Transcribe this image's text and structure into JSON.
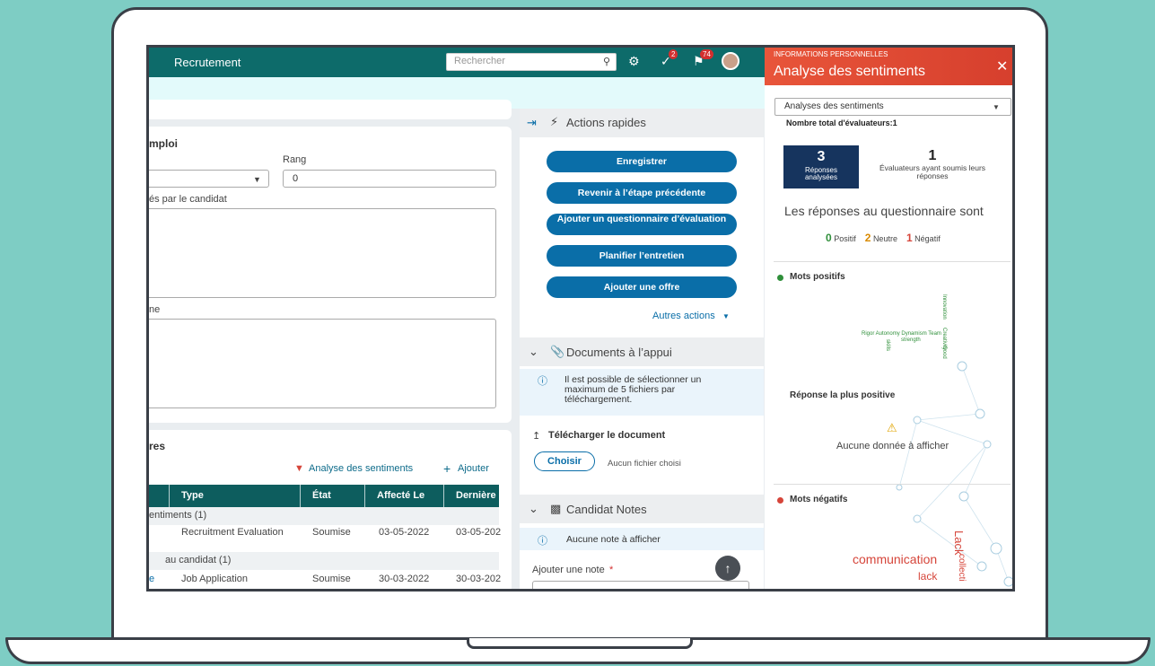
{
  "topbar": {
    "title": "Recrutement",
    "search_placeholder": "Rechercher",
    "badge_1": "2",
    "badge_2": "74"
  },
  "form": {
    "section_title": "mploi",
    "rank_label": "Rang",
    "rank_value": "0",
    "candidate_label": "és par le candidat",
    "other_label": "ne"
  },
  "evaluations": {
    "section_title": "res",
    "sentiment_link": "Analyse des sentiments",
    "add_link": "Ajouter",
    "columns": [
      "Type",
      "État",
      "Affecté Le",
      "Dernière"
    ],
    "groups": [
      {
        "label": "entiments (1)",
        "rows": [
          {
            "type": "Recruitment Evaluation",
            "state": "Soumise",
            "assigned": "03-05-2022",
            "last": "03-05-202"
          }
        ]
      },
      {
        "label": "au candidat (1)",
        "rows": [
          {
            "type": "Job Application",
            "state": "Soumise",
            "assigned": "30-03-2022",
            "last": "30-03-202"
          }
        ]
      }
    ]
  },
  "quick_actions": {
    "title": "Actions rapides",
    "buttons": [
      "Enregistrer",
      "Revenir à l’étape précédente",
      "Ajouter un questionnaire d’évaluation",
      "Planifier l’entretien",
      "Ajouter une offre"
    ],
    "more": "Autres actions"
  },
  "documents": {
    "title": "Documents à l’appui",
    "info": "Il est possible de sélectionner un maximum de 5 fichiers par téléchargement.",
    "upload_label": "Télécharger le document",
    "choose_button": "Choisir",
    "no_file": "Aucun fichier choisi"
  },
  "notes": {
    "title": "Candidat Notes",
    "empty": "Aucune note à afficher",
    "add_label": "Ajouter une note",
    "required_mark": "*"
  },
  "sentiment_panel": {
    "kicker": "INFORMATIONS PERSONNELLES",
    "title": "Analyse des sentiments",
    "select_value": "Analyses des sentiments",
    "total_evaluators": "Nombre total d'évaluateurs:1",
    "responses_count": "3",
    "responses_label": "Réponses analysées",
    "evaluators_count": "1",
    "evaluators_label": "Évaluateurs ayant soumis leurs réponses",
    "summary_title": "Les réponses au questionnaire sont",
    "positive_count": "0",
    "positive_label": "Positif",
    "neutral_count": "2",
    "neutral_label": "Neutre",
    "negative_count": "1",
    "negative_label": "Négatif",
    "positive_words_title": "Mots positifs",
    "positive_words_line": "Rigor Autonomy Dynamism Team",
    "positive_word_strength": "strength",
    "positive_word_skills": "skills",
    "positive_vertical_1": "Innovation",
    "positive_vertical_2": "Creativity",
    "positive_vertical_3": "Good",
    "most_positive_title": "Réponse la plus positive",
    "no_data": "Aucune donnée à afficher",
    "negative_words_title": "Mots négatifs",
    "negative_word_1": "communication",
    "negative_word_2": "lack",
    "negative_vertical_1": "Lack",
    "negative_vertical_2": "collecti"
  },
  "colors": {
    "topbar": "#0d6b6a",
    "button": "#0a6ea8",
    "panel_header": "#e0492f",
    "stat_box": "#16345e",
    "positive": "#2f8f3a",
    "neutral": "#d98a00",
    "negative": "#d6453a"
  }
}
